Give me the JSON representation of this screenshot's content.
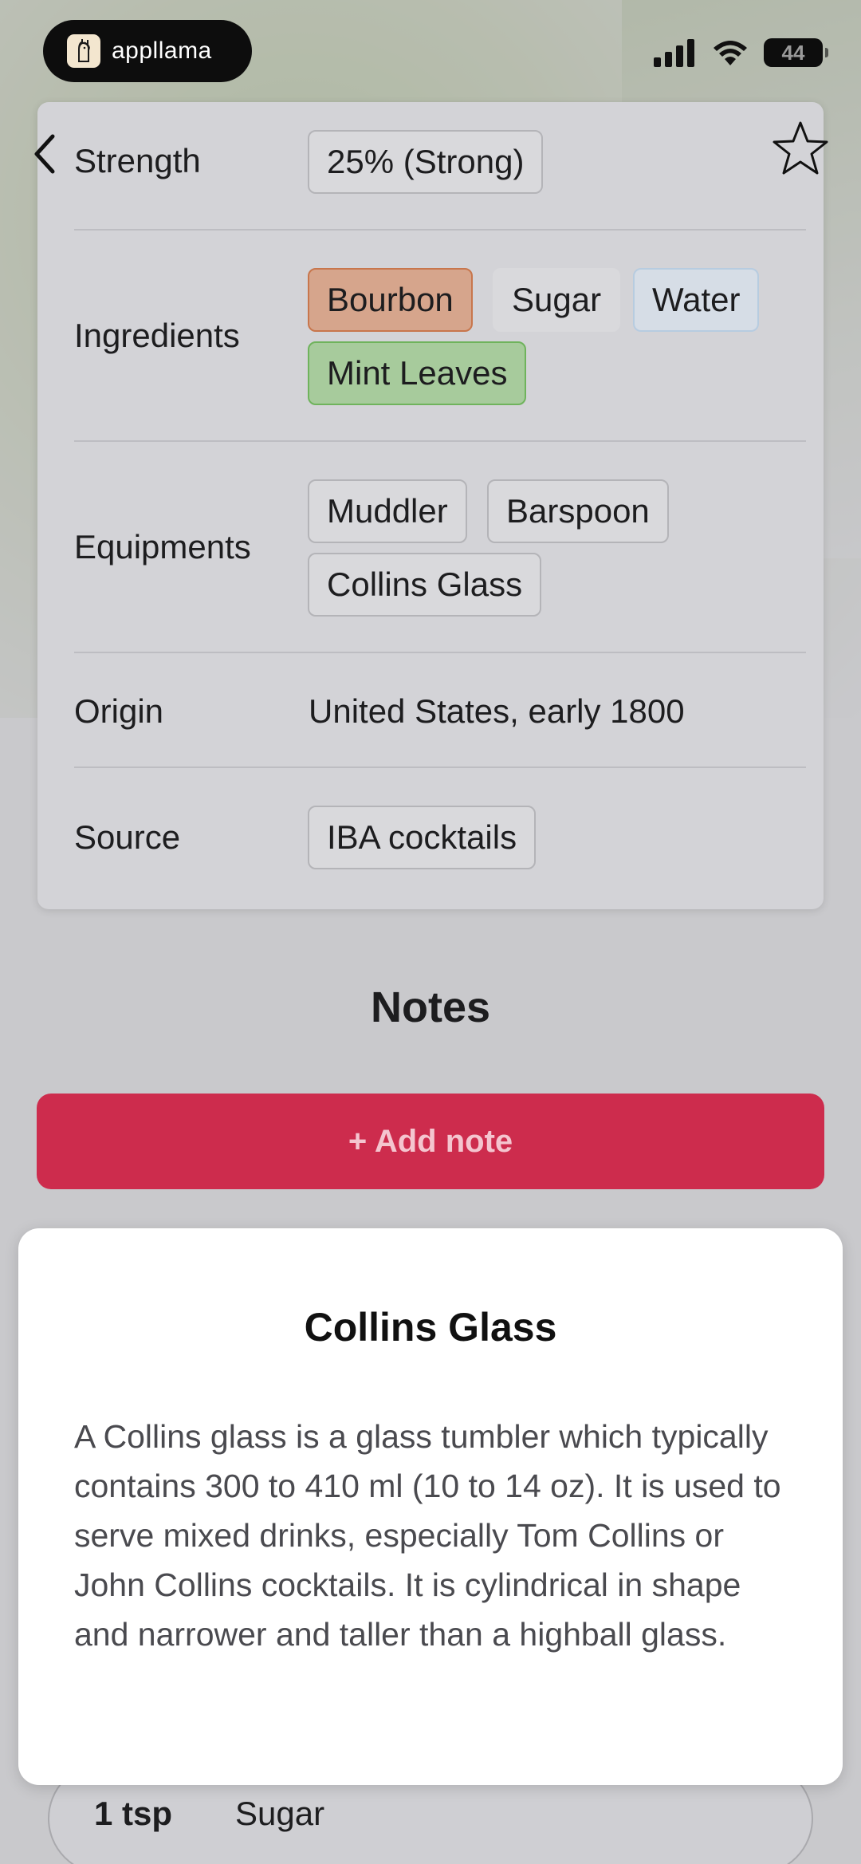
{
  "status_bar": {
    "brand": "appllama",
    "battery": "44"
  },
  "details": {
    "strength": {
      "label": "Strength",
      "value": "25% (Strong)"
    },
    "ingredients": {
      "label": "Ingredients",
      "items": [
        "Bourbon",
        "Sugar",
        "Water",
        "Mint Leaves"
      ]
    },
    "equipments": {
      "label": "Equipments",
      "items": [
        "Muddler",
        "Barspoon",
        "Collins Glass"
      ]
    },
    "origin": {
      "label": "Origin",
      "value": "United States, early 1800"
    },
    "source": {
      "label": "Source",
      "value": "IBA cocktails"
    }
  },
  "notes": {
    "title": "Notes",
    "add_label": "+ Add note"
  },
  "measure": {
    "qty": "1 tsp",
    "name": "Sugar"
  },
  "popup": {
    "title": "Collins Glass",
    "body": "A Collins glass is a glass tumbler which typically contains 300 to 410 ml (10 to 14 oz). It is used to serve mixed drinks, especially Tom Collins or John Collins cocktails. It is cylindrical in shape and narrower and taller than a highball glass."
  },
  "colors": {
    "accent": "#cd2c4d",
    "bourbon_chip": "#d6a58c",
    "mint_chip": "#a7cb9c",
    "water_chip": "#d6dde6"
  }
}
